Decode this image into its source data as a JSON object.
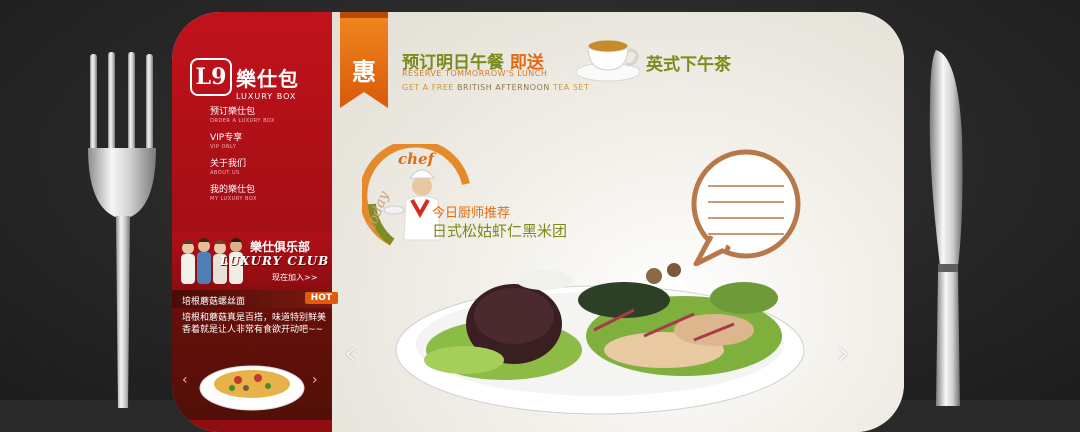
{
  "brand": {
    "mark": "L9",
    "name_cn": "樂仕包",
    "name_en": "LUXURY BOX"
  },
  "nav": [
    {
      "cn": "预订樂仕包",
      "en": "ORDER A LUXURY BOX"
    },
    {
      "cn": "VIP专享",
      "en": "VIP ONLY"
    },
    {
      "cn": "关于我们",
      "en": "ABOUT US"
    },
    {
      "cn": "我的樂仕包",
      "en": "MY LUXURY BOX"
    }
  ],
  "club": {
    "cn": "樂仕俱乐部",
    "en": "LUXURY CLUB",
    "join": "现在加入>>"
  },
  "hot": {
    "title": "培根蘑菇螺丝面",
    "tag": "HOT",
    "desc": "培根和蘑菇真是百搭，味道特别鲜美香着就是让人非常有食欲开动吧~~",
    "prev": "‹",
    "next": "›"
  },
  "promo": {
    "ribbon_char": "惠",
    "line1_a": "预订明日午餐",
    "line1_b": "即送",
    "line1_c": "英式下午茶",
    "en1": "RESERVE TOMMORROW'S LUNCH",
    "en2_a": "GET A FREE",
    "en2_b": "BRITISH AFTERNOON",
    "en2_c": "TEA SET"
  },
  "chef": {
    "badge_today": "today",
    "badge_chef": "chef",
    "rec_label": "今日厨师推荐",
    "dish_name": "日式松姑虾仁黑米团"
  },
  "carousel": {
    "prev": "‹",
    "next": "›"
  },
  "colors": {
    "sidebar_red": "#c1121c",
    "accent_orange": "#e06b13",
    "olive_green": "#7a8a1b",
    "background": "#2a2a2a"
  }
}
